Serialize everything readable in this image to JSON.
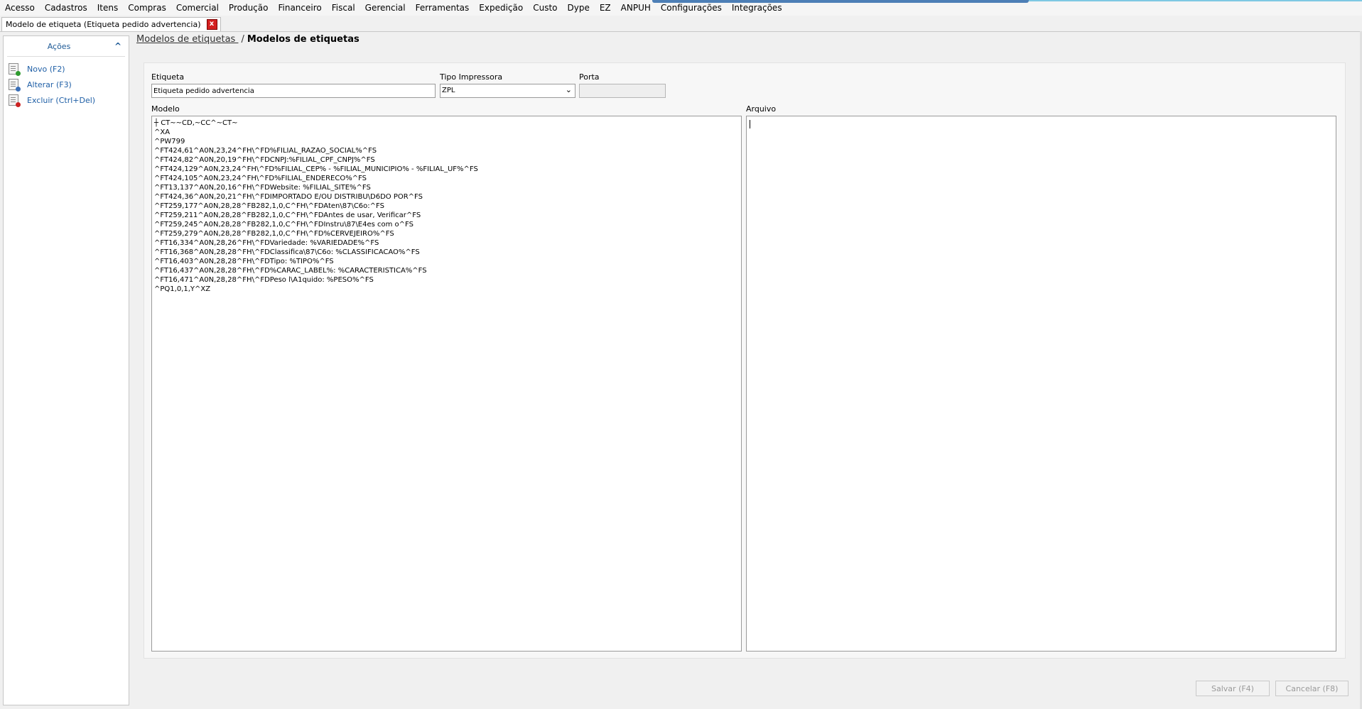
{
  "menu": [
    "Acesso",
    "Cadastros",
    "Itens",
    "Compras",
    "Comercial",
    "Produção",
    "Financeiro",
    "Fiscal",
    "Gerencial",
    "Ferramentas",
    "Expedição",
    "Custo",
    "Dype",
    "EZ",
    "ANPUH",
    "Configurações",
    "Integrações"
  ],
  "tab": {
    "label": "Modelo de etiqueta (Etiqueta pedido advertencia)",
    "close_glyph": "x"
  },
  "sidebar": {
    "title": "Ações",
    "collapse_glyph": "^",
    "actions": [
      {
        "label": "Novo (F2)",
        "icon": "new-document-icon",
        "badge_color": "#2e9b2e"
      },
      {
        "label": "Alterar (F3)",
        "icon": "edit-document-icon",
        "badge_color": "#3a6fb8"
      },
      {
        "label": "Excluir (Ctrl+Del)",
        "icon": "delete-document-icon",
        "badge_color": "#cc2222"
      }
    ]
  },
  "breadcrumb": {
    "link": "Modelos de etiquetas ",
    "separator": "/",
    "current": "Modelos de etiquetas"
  },
  "form": {
    "etiqueta_label": "Etiqueta",
    "etiqueta_value": "Etiqueta pedido advertencia",
    "tipo_label": "Tipo Impressora",
    "tipo_value": "ZPL",
    "porta_label": "Porta",
    "porta_value": "",
    "modelo_label": "Modelo",
    "modelo_value": "┼ CT~~CD,~CC^~CT~\n^XA\n^PW799\n^FT424,61^A0N,23,24^FH\\^FD%FILIAL_RAZAO_SOCIAL%^FS\n^FT424,82^A0N,20,19^FH\\^FDCNPJ:%FILIAL_CPF_CNPJ%^FS\n^FT424,129^A0N,23,24^FH\\^FD%FILIAL_CEP% - %FILIAL_MUNICIPIO% - %FILIAL_UF%^FS\n^FT424,105^A0N,23,24^FH\\^FD%FILIAL_ENDERECO%^FS\n^FT13,137^A0N,20,16^FH\\^FDWebsite: %FILIAL_SITE%^FS\n^FT424,36^A0N,20,21^FH\\^FDIMPORTADO E/OU DISTRIBU\\D6DO POR^FS\n^FT259,177^A0N,28,28^FB282,1,0,C^FH\\^FDAten\\87\\C6o:^FS\n^FT259,211^A0N,28,28^FB282,1,0,C^FH\\^FDAntes de usar, Verificar^FS\n^FT259,245^A0N,28,28^FB282,1,0,C^FH\\^FDInstru\\87\\E4es com o^FS\n^FT259,279^A0N,28,28^FB282,1,0,C^FH\\^FD%CERVEJEIRO%^FS\n^FT16,334^A0N,28,26^FH\\^FDVariedade: %VARIEDADE%^FS\n^FT16,368^A0N,28,28^FH\\^FDClassifica\\87\\C6o: %CLASSIFICACAO%^FS\n^FT16,403^A0N,28,28^FH\\^FDTipo: %TIPO%^FS\n^FT16,437^A0N,28,28^FH\\^FD%CARAC_LABEL%: %CARACTERISTICA%^FS\n^FT16,471^A0N,28,28^FH\\^FDPeso l\\A1quido: %PESO%^FS\n^PQ1,0,1,Y^XZ",
    "arquivo_label": "Arquivo",
    "arquivo_value": ""
  },
  "buttons": {
    "save": "Salvar (F4)",
    "cancel": "Cancelar (F8)"
  },
  "colors": {
    "link": "#1f5fa6",
    "menu_accent": "#4d7fb6"
  }
}
